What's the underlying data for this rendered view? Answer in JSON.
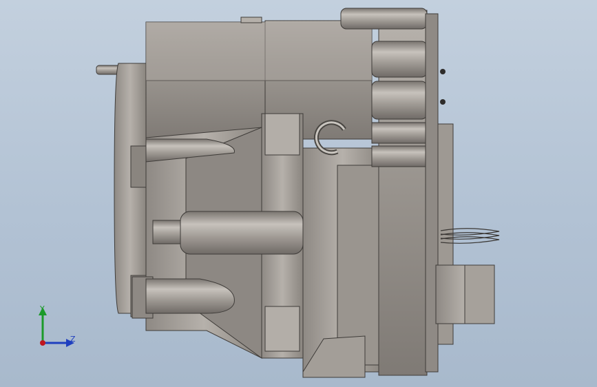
{
  "viewport": {
    "background_top": "#c3d0de",
    "background_bottom": "#a8b9cc"
  },
  "model": {
    "description_icon": "cad-assembly-side-view-icon",
    "body_color": "#9c9791",
    "shadow_color": "#5e5a56",
    "highlight_color": "#c9c5bf"
  },
  "triad": {
    "y_label": "Y",
    "z_label": "Z",
    "y_color": "#1b9a2a",
    "z_color": "#1f3fbf",
    "origin_color": "#c0161f"
  }
}
